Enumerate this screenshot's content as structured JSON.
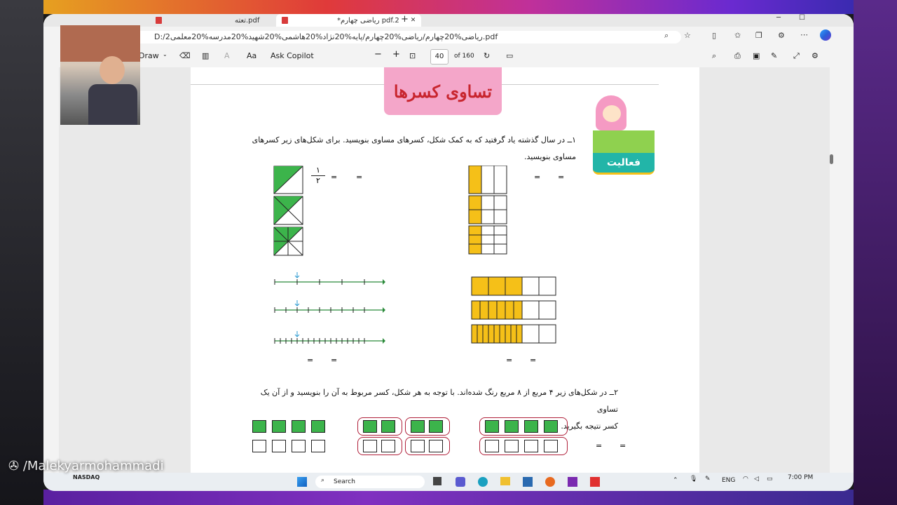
{
  "browser": {
    "tabs": [
      {
        "title": "تعته.pdf"
      },
      {
        "title": "*ریاضی چهارم pdf.2"
      }
    ],
    "new_tab": "+",
    "url": "D:/2ریاضی%20چهارم/ریاضی%20چهارم/پایه%20نژاد%20هاشمی%20شهید%20مدرسه%20معلمی.pdf"
  },
  "pdf_toolbar": {
    "draw_label": "Draw",
    "copilot_label": "Ask Copilot",
    "current_page": "40",
    "page_total": "of 160",
    "zoom_minus": "−",
    "zoom_plus": "+"
  },
  "document": {
    "title": "تساوی کسرها",
    "activity_label": "فعالیت",
    "q1_line1": "۱ــ در سال گذشته یاد گرفتید که به کمک شکل، کسرهای مساوی بنویسید. برای شکل‌های زیر کسرهای",
    "q1_line2": "مساوی بنویسید.",
    "fraction_top": "۱",
    "fraction_bottom": "۲",
    "equals": "=",
    "q2_line1": "۲ــ در شکل‌های زیر ۴ مربع از ۸ مربع رنگ شده‌اند. با توجه به هر شکل، کسر مربوط به آن را بنویسید و از آن یک تساوی",
    "q2_line2": "کسر نتیجه بگیرید."
  },
  "overlay": {
    "watermark": "/Malekyarmohammadi"
  },
  "taskbar": {
    "search_label": "Search",
    "stock_name": "NASDAQ",
    "lang": "ENG",
    "time": "7:00 PM"
  },
  "colors": {
    "green": "#3cb44b",
    "yellow": "#f5c018",
    "pink_title": "#f4a6c9",
    "teal_activity": "#22b5a8"
  }
}
